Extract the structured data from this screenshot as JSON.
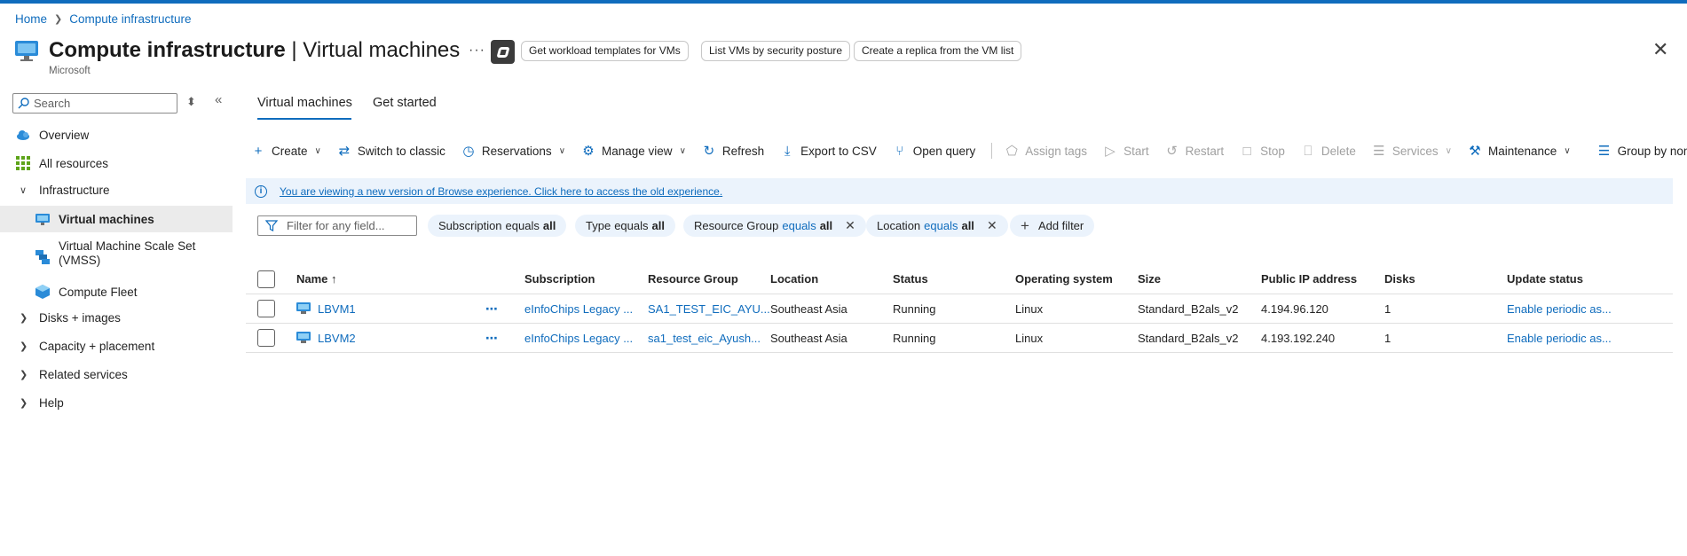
{
  "breadcrumb": {
    "home": "Home",
    "current": "Compute infrastructure"
  },
  "header": {
    "title_main": "Compute infrastructure",
    "title_sep": " | ",
    "title_sub": "Virtual machines",
    "publisher": "Microsoft",
    "more": "···",
    "pills": [
      "Get workload templates for VMs",
      "List VMs by security posture",
      "Create a replica from the VM list"
    ],
    "close": "✕"
  },
  "sidebar": {
    "search_placeholder": "Search",
    "items": [
      {
        "label": "Overview",
        "icon": "cloud-icon"
      },
      {
        "label": "All resources",
        "icon": "grid-icon"
      },
      {
        "label": "Infrastructure",
        "icon": "chevron-down-icon"
      },
      {
        "label": "Virtual machines",
        "icon": "vm-icon",
        "active": true
      },
      {
        "label": "Virtual Machine Scale Set",
        "label2": "(VMSS)",
        "icon": "vmss-icon"
      },
      {
        "label": "Compute Fleet",
        "icon": "fleet-icon"
      },
      {
        "label": "Disks + images",
        "icon": "chevron-right-icon"
      },
      {
        "label": "Capacity + placement",
        "icon": "chevron-right-icon"
      },
      {
        "label": "Related services",
        "icon": "chevron-right-icon"
      },
      {
        "label": "Help",
        "icon": "chevron-right-icon"
      }
    ]
  },
  "tabs": [
    "Virtual machines",
    "Get started"
  ],
  "toolbar": {
    "create": "Create",
    "switch_classic": "Switch to classic",
    "reservations": "Reservations",
    "manage_view": "Manage view",
    "refresh": "Refresh",
    "export_csv": "Export to CSV",
    "open_query": "Open query",
    "assign_tags": "Assign tags",
    "start": "Start",
    "restart": "Restart",
    "stop": "Stop",
    "delete": "Delete",
    "services": "Services",
    "maintenance": "Maintenance",
    "group_by": "Group by none"
  },
  "banner": {
    "text": "You are viewing a new version of Browse experience. Click here to access the old experience."
  },
  "filters": {
    "placeholder": "Filter for any field...",
    "chips": [
      {
        "field": "Subscription",
        "op": "equals",
        "value": "all"
      },
      {
        "field": "Type",
        "op": "equals",
        "value": "all"
      },
      {
        "field": "Resource Group",
        "op": "equals",
        "value": "all"
      },
      {
        "field": "Location",
        "op": "equals",
        "value": "all"
      }
    ],
    "add_filter": "Add filter"
  },
  "table": {
    "columns": [
      "Name ↑",
      "Subscription",
      "Resource Group",
      "Location",
      "Status",
      "Operating system",
      "Size",
      "Public IP address",
      "Disks",
      "Update status"
    ],
    "rows": [
      {
        "name": "LBVM1",
        "subscription": "eInfoChips Legacy ...",
        "resource_group": "SA1_TEST_EIC_AYU...",
        "location": "Southeast Asia",
        "status": "Running",
        "os": "Linux",
        "size": "Standard_B2als_v2",
        "ip": "4.194.96.120",
        "disks": "1",
        "update": "Enable periodic as..."
      },
      {
        "name": "LBVM2",
        "subscription": "eInfoChips Legacy ...",
        "resource_group": "sa1_test_eic_Ayush...",
        "location": "Southeast Asia",
        "status": "Running",
        "os": "Linux",
        "size": "Standard_B2als_v2",
        "ip": "4.193.192.240",
        "disks": "1",
        "update": "Enable periodic as..."
      }
    ]
  },
  "colors": {
    "accent": "#0f6cbd",
    "banner_bg": "#ebf3fc",
    "active_nav": "#ebebeb"
  }
}
